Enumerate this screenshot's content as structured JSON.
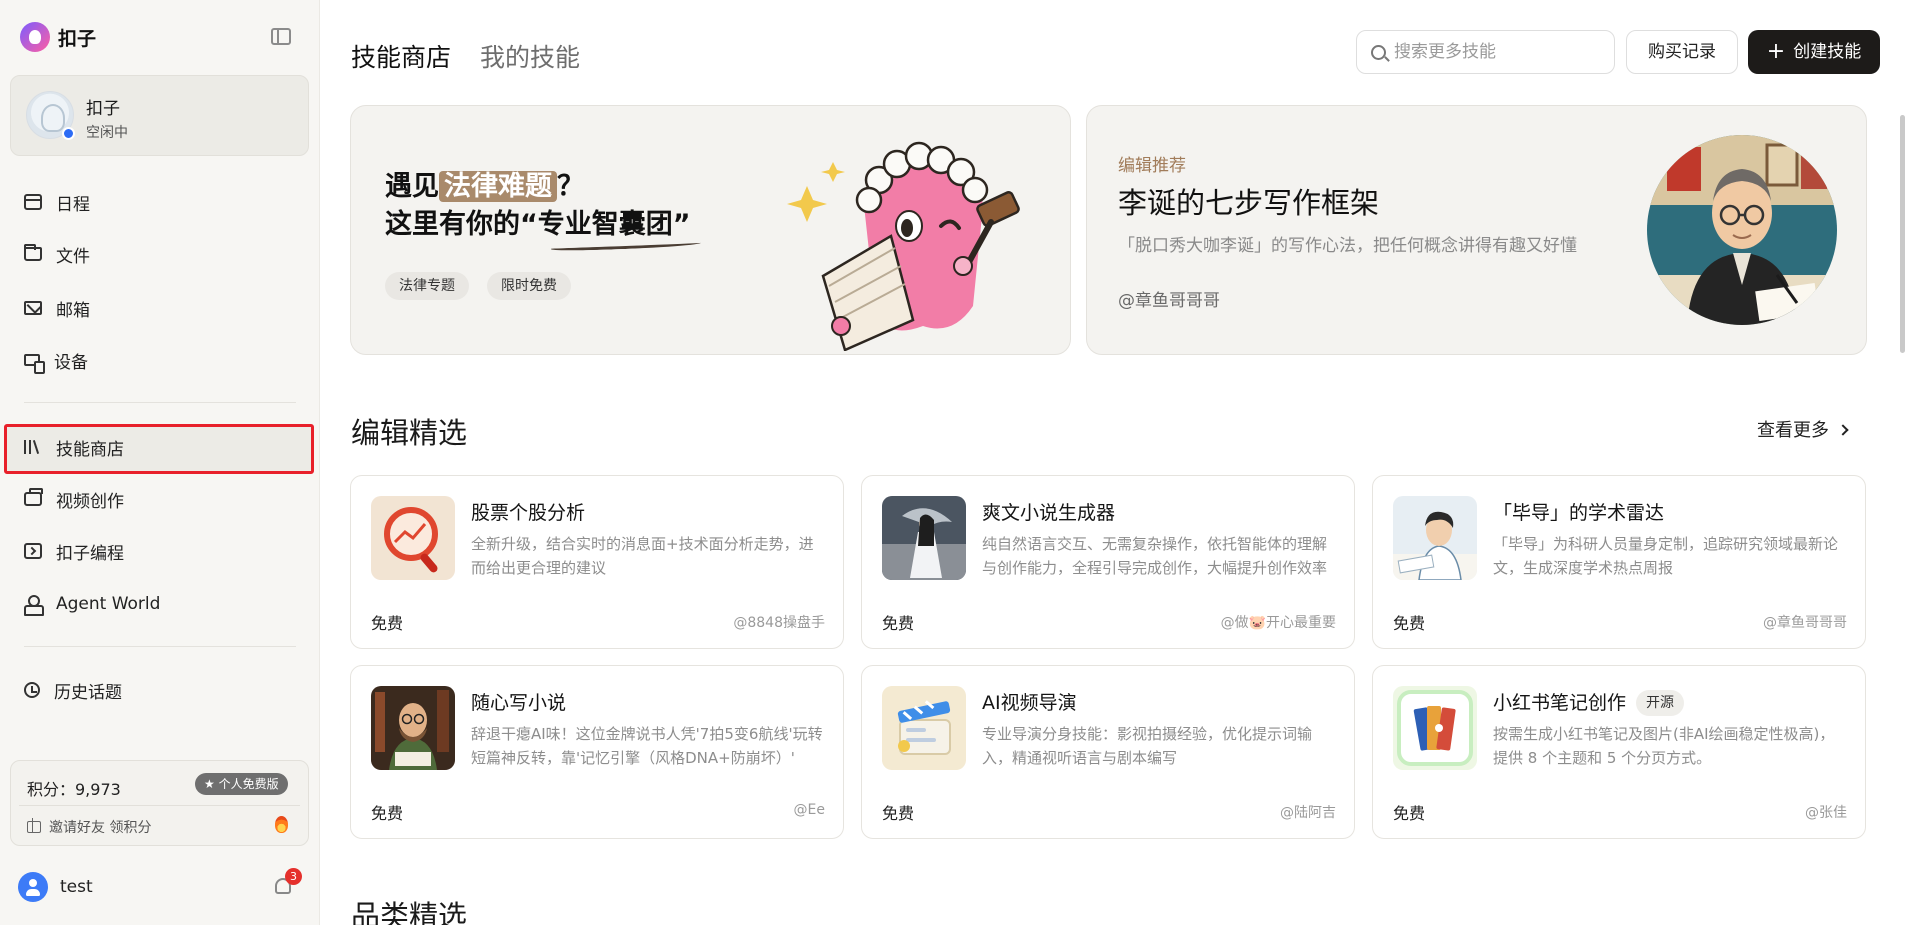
{
  "sidebar": {
    "brand": "扣子",
    "agent": {
      "name": "扣子",
      "status": "空闲中"
    },
    "nav": [
      {
        "label": "日程",
        "icon": "calendar-icon"
      },
      {
        "label": "文件",
        "icon": "folder-icon"
      },
      {
        "label": "邮箱",
        "icon": "mail-icon"
      },
      {
        "label": "设备",
        "icon": "device-icon"
      },
      {
        "label": "技能商店",
        "icon": "library-icon",
        "selected": true
      },
      {
        "label": "视频创作",
        "icon": "video-icon"
      },
      {
        "label": "扣子编程",
        "icon": "code-icon"
      },
      {
        "label": "Agent World",
        "icon": "agent-world-icon"
      },
      {
        "label": "历史话题",
        "icon": "history-icon"
      }
    ],
    "points": {
      "label": "积分：9,973",
      "badge": "★ 个人免费版",
      "invite": "邀请好友 领积分"
    },
    "user": {
      "name": "test",
      "notifications": "3"
    }
  },
  "header": {
    "tabs": [
      {
        "label": "技能商店",
        "active": true
      },
      {
        "label": "我的技能",
        "active": false
      }
    ],
    "search_placeholder": "搜索更多技能",
    "purchase_label": "购买记录",
    "create_label": "创建技能"
  },
  "banners": {
    "left": {
      "line1_pre": "遇见",
      "line1_highlight": "法律难题",
      "line1_post": "？",
      "line2": "这里有你的“专业智囊团”",
      "tags": [
        "法律专题",
        "限时免费"
      ]
    },
    "right": {
      "kicker": "编辑推荐",
      "title": "李诞的七步写作框架",
      "desc": "「脱口秀大咖李诞」的写作心法，把任何概念讲得有趣又好懂",
      "author": "@章鱼哥哥哥"
    }
  },
  "sections": {
    "editor_pick": {
      "title": "编辑精选",
      "see_more": "查看更多"
    },
    "category_pick": {
      "title": "品类精选"
    }
  },
  "cards": [
    {
      "title": "股票个股分析",
      "tag": "",
      "desc": "全新升级，结合实时的消息面+技术面分析走势，进而给出更合理的建议",
      "price": "免费",
      "author": "@8848操盘手",
      "thumb": "stock-analysis-icon"
    },
    {
      "title": "爽文小说生成器",
      "tag": "",
      "desc": "纯自然语言交互、无需复杂操作，依托智能体的理解与创作能力，全程引导完成创作，大幅提升创作效率",
      "price": "免费",
      "author": "@做🐷开心最重要",
      "thumb": "novel-generator-icon"
    },
    {
      "title": "「毕导」的学术雷达",
      "tag": "",
      "desc": "「毕导」为科研人员量身定制，追踪研究领域最新论文，生成深度学术热点周报",
      "price": "免费",
      "author": "@章鱼哥哥哥",
      "thumb": "academic-radar-icon"
    },
    {
      "title": "随心写小说",
      "tag": "",
      "desc": "辞退干瘪AI味！这位金牌说书人凭'7拍5变6航线'玩转短篇神反转，靠'记忆引擎（风格DNA+防崩坏）'",
      "price": "免费",
      "author": "@Ee",
      "thumb": "write-novel-icon"
    },
    {
      "title": "AI视频导演",
      "tag": "",
      "desc": "专业导演分身技能：影视拍摄经验，优化提示词输入，精通视听语言与剧本编写",
      "price": "免费",
      "author": "@陆阿吉",
      "thumb": "video-director-icon"
    },
    {
      "title": "小红书笔记创作",
      "tag": "开源",
      "desc": "按需生成小红书笔记及图片(非AI绘画稳定性极高)，提供 8 个主题和 5 个分页方式。",
      "price": "免费",
      "author": "@张佳",
      "thumb": "xhs-notes-icon"
    }
  ],
  "colors": {
    "accent_dark": "#1d1b19",
    "selected_outline": "#e8202a",
    "highlight": "#a98a6b",
    "kicker": "#a17c5a"
  }
}
